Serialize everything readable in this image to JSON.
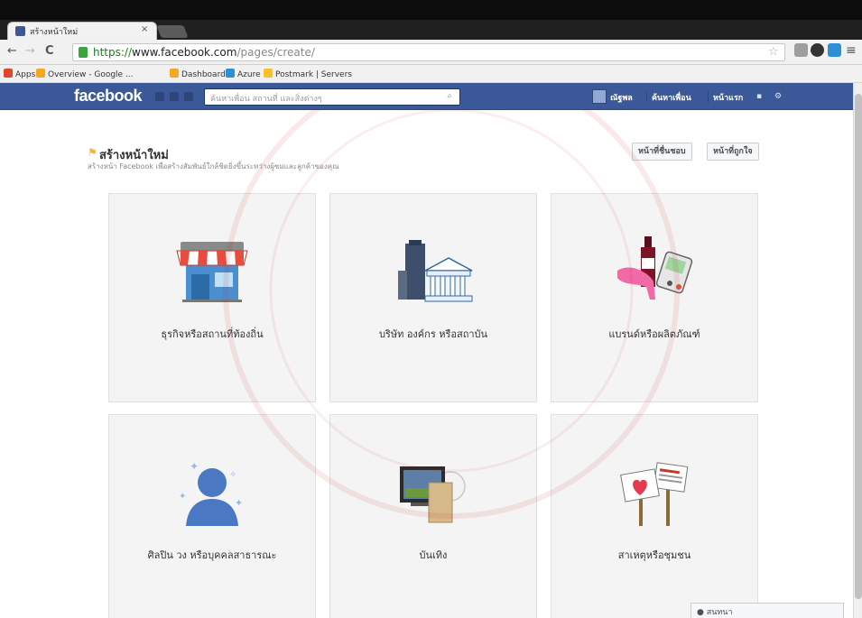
{
  "browser": {
    "tab_title": "สร้างหน้าใหม่",
    "tab_close": "×",
    "url_scheme": "https://",
    "url_host": "www.facebook.com",
    "url_path": "/pages/create/",
    "bookmarks": [
      {
        "label": "Apps",
        "color": "#e0462b"
      },
      {
        "label": "Overview - Google ...",
        "color": "#f5a623"
      },
      {
        "label": "Dashboard",
        "color": "#f5a623"
      },
      {
        "label": "Azure",
        "color": "#2d8fd5"
      },
      {
        "label": "Postmark | Servers",
        "color": "#f5c323"
      }
    ]
  },
  "facebook": {
    "logo": "facebook",
    "search_placeholder": "ค้นหาเพื่อน สถานที่ และสิ่งต่างๆ",
    "nav_user": "ณัฐพล",
    "nav_find_friends": "ค้นหาเพื่อน",
    "nav_home": "หน้าแรก",
    "colors": {
      "brand": "#3b5998",
      "page_bg": "#ffffff",
      "card_bg": "#f4f4f4"
    }
  },
  "create_page": {
    "title": "สร้างหน้าใหม่",
    "subtitle": "สร้างหน้า Facebook เพื่อสร้างสัมพันธ์ใกล้ชิดยิ่งขึ้นระหว่างผู้ชมและลูกค้าของคุณ",
    "btn_liked_pages": "หน้าที่ชื่นชอบ",
    "btn_my_pages": "หน้าที่ถูกใจ",
    "categories": [
      {
        "label": "ธุรกิจหรือสถานที่ท้องถิ่น",
        "icon": "storefront-icon"
      },
      {
        "label": "บริษัท องค์กร หรือสถาบัน",
        "icon": "company-building-icon"
      },
      {
        "label": "แบรนด์หรือผลิตภัณฑ์",
        "icon": "brand-product-icon"
      },
      {
        "label": "ศิลปิน วง หรือบุคคลสาธารณะ",
        "icon": "public-figure-icon"
      },
      {
        "label": "บันเทิง",
        "icon": "entertainment-icon"
      },
      {
        "label": "สาเหตุหรือชุมชน",
        "icon": "cause-community-icon"
      }
    ]
  },
  "chat": {
    "label": "สนทนา"
  }
}
